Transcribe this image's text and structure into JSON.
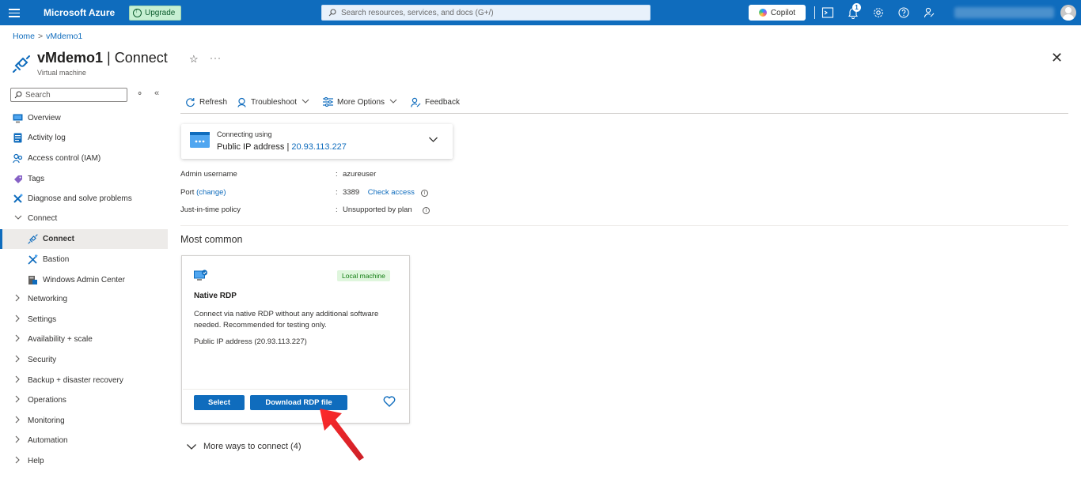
{
  "topbar": {
    "brand": "Microsoft Azure",
    "upgrade_label": "Upgrade",
    "search_placeholder": "Search resources, services, and docs (G+/)",
    "copilot_label": "Copilot",
    "notifications_count": "1"
  },
  "breadcrumb": {
    "home": "Home",
    "current": "vMdemo1"
  },
  "header": {
    "resource_name": "vMdemo1",
    "page_name": "Connect",
    "separator": "|",
    "subtitle": "Virtual machine"
  },
  "sidebar": {
    "search_placeholder": "Search",
    "items": [
      {
        "label": "Overview",
        "icon": "monitor-icon"
      },
      {
        "label": "Activity log",
        "icon": "activity-log-icon"
      },
      {
        "label": "Access control (IAM)",
        "icon": "people-icon"
      },
      {
        "label": "Tags",
        "icon": "tag-icon"
      },
      {
        "label": "Diagnose and solve problems",
        "icon": "wrench-icon"
      },
      {
        "label": "Connect",
        "icon": "chevron-down-icon"
      },
      {
        "label": "Connect",
        "icon": "plug-icon"
      },
      {
        "label": "Bastion",
        "icon": "bastion-icon"
      },
      {
        "label": "Windows Admin Center",
        "icon": "admin-center-icon"
      },
      {
        "label": "Networking",
        "icon": "chevron-right-icon"
      },
      {
        "label": "Settings",
        "icon": "chevron-right-icon"
      },
      {
        "label": "Availability + scale",
        "icon": "chevron-right-icon"
      },
      {
        "label": "Security",
        "icon": "chevron-right-icon"
      },
      {
        "label": "Backup + disaster recovery",
        "icon": "chevron-right-icon"
      },
      {
        "label": "Operations",
        "icon": "chevron-right-icon"
      },
      {
        "label": "Monitoring",
        "icon": "chevron-right-icon"
      },
      {
        "label": "Automation",
        "icon": "chevron-right-icon"
      },
      {
        "label": "Help",
        "icon": "chevron-right-icon"
      }
    ]
  },
  "toolbar": {
    "refresh": "Refresh",
    "troubleshoot": "Troubleshoot",
    "more_options": "More Options",
    "feedback": "Feedback"
  },
  "connection": {
    "connecting_using": "Connecting using",
    "method": "Public IP address |",
    "ip": "20.93.113.227"
  },
  "details": {
    "admin_username_label": "Admin username",
    "admin_username_value": "azureuser",
    "port_label": "Port",
    "port_change": "(change)",
    "port_value": "3389",
    "check_access": "Check access",
    "jit_label": "Just-in-time policy",
    "jit_value": "Unsupported by plan",
    "colon": ":"
  },
  "most_common": {
    "heading": "Most common",
    "card": {
      "tag": "Local machine",
      "title": "Native RDP",
      "description": "Connect via native RDP without any additional software needed. Recommended for testing only.",
      "ip_line": "Public IP address (20.93.113.227)",
      "select_label": "Select",
      "download_label": "Download RDP file"
    }
  },
  "more_ways": "More ways to connect (4)",
  "colors": {
    "accent": "#0f6cbd",
    "tag_bg": "#dff6dd",
    "tag_fg": "#107c10",
    "arrow": "#e8212b"
  }
}
